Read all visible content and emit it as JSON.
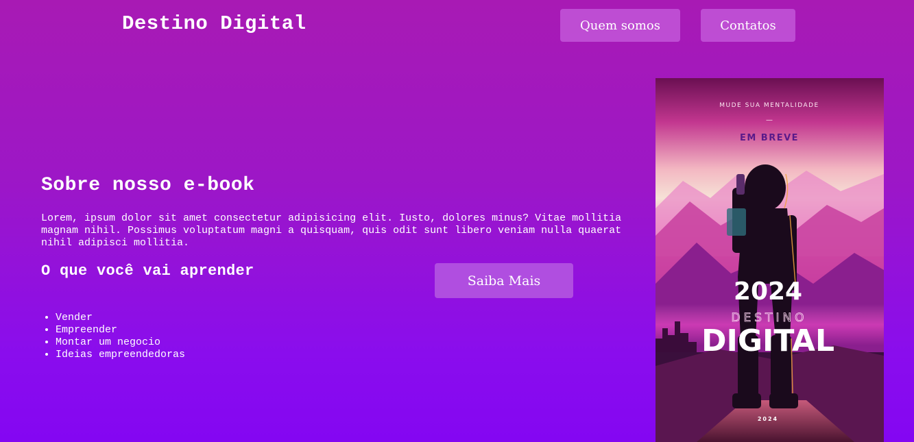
{
  "header": {
    "brand": "Destino Digital",
    "nav": [
      "Quem somos",
      "Contatos"
    ]
  },
  "about": {
    "title": "Sobre nosso e-book",
    "text": "Lorem, ipsum dolor sit amet consectetur adipisicing elit. Iusto, dolores minus? Vitae mollitia magnam nihil. Possimus voluptatum magni a quisquam, quis odit sunt libero veniam nulla quaerat nihil adipisci mollitia."
  },
  "learn": {
    "title": "O que você vai aprender",
    "items": [
      "Vender",
      "Empreender",
      "Montar um negocio",
      "Ideias empreendedoras"
    ]
  },
  "cta": {
    "label": "Saiba Mais"
  },
  "cover": {
    "tagline": "MUDE SUA MENTALIDADE",
    "dash": "—",
    "soon": "EM BREVE",
    "year": "2024",
    "word1": "DESTINO",
    "word2": "DIGITAL",
    "footer_year": "2024"
  },
  "colors": {
    "bg_top": "#a81ab4",
    "bg_bottom": "#8406f2",
    "nav_button": "#c56ee0",
    "cta_button": "#b04ee0"
  }
}
